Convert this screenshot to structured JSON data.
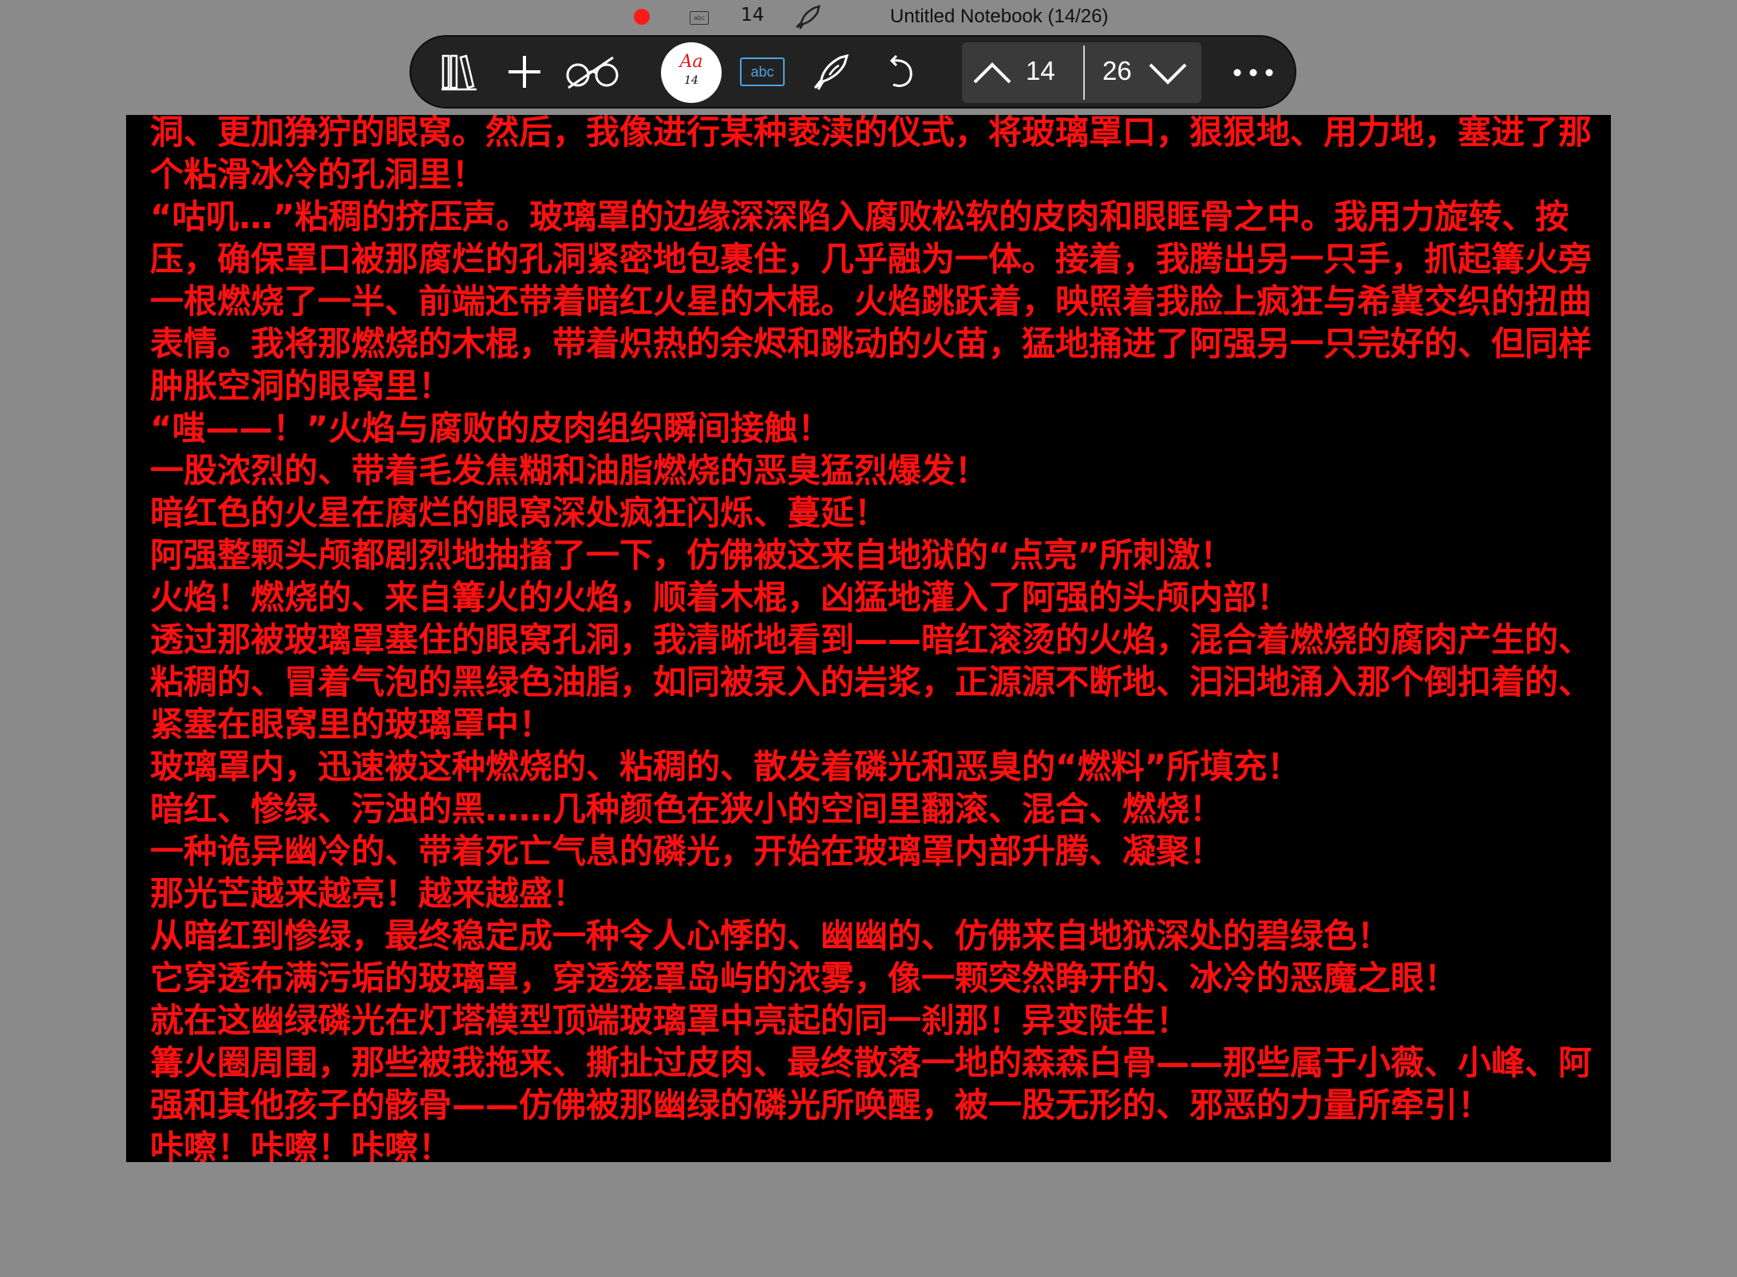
{
  "statusbar": {
    "record_indicator": "record-dot",
    "abc_icon": "abc",
    "page_number": "14",
    "window_title": "Untitled Notebook (14/26)"
  },
  "toolbar": {
    "font_button": {
      "label": "Aa",
      "size": "14"
    },
    "abc_label": "abc",
    "current_page": "14",
    "total_pages": "26",
    "icons": [
      "library-icon",
      "add-icon",
      "glasses-icon",
      "font-icon",
      "abc-icon",
      "pen-hand-icon",
      "undo-icon",
      "chevron-up-icon",
      "chevron-down-icon",
      "more-icon"
    ]
  },
  "document": {
    "paragraphs": [
      "洞、更加狰狞的眼窝。然后，我像进行某种亵渎的仪式，将玻璃罩口，狠狠地、用力地，塞进了那个粘滑冰冷的孔洞里！",
      "“咕叽…”粘稠的挤压声。玻璃罩的边缘深深陷入腐败松软的皮肉和眼眶骨之中。我用力旋转、按压，确保罩口被那腐烂的孔洞紧密地包裹住，几乎融为一体。接着，我腾出另一只手，抓起篝火旁一根燃烧了一半、前端还带着暗红火星的木棍。火焰跳跃着，映照着我脸上疯狂与希冀交织的扭曲表情。我将那燃烧的木棍，带着炽热的余烬和跳动的火苗，猛地捅进了阿强另一只完好的、但同样肿胀空洞的眼窝里！",
      "“嗤——！”火焰与腐败的皮肉组织瞬间接触！",
      "一股浓烈的、带着毛发焦糊和油脂燃烧的恶臭猛烈爆发！",
      "暗红色的火星在腐烂的眼窝深处疯狂闪烁、蔓延！",
      "阿强整颗头颅都剧烈地抽搐了一下，仿佛被这来自地狱的“点亮”所刺激！",
      "火焰！燃烧的、来自篝火的火焰，顺着木棍，凶猛地灌入了阿强的头颅内部！",
      "透过那被玻璃罩塞住的眼窝孔洞，我清晰地看到——暗红滚烫的火焰，混合着燃烧的腐肉产生的、粘稠的、冒着气泡的黑绿色油脂，如同被泵入的岩浆，正源源不断地、汩汩地涌入那个倒扣着的、紧塞在眼窝里的玻璃罩中！",
      "玻璃罩内，迅速被这种燃烧的、粘稠的、散发着磷光和恶臭的“燃料”所填充！",
      "暗红、惨绿、污浊的黑……几种颜色在狭小的空间里翻滚、混合、燃烧！",
      "一种诡异幽冷的、带着死亡气息的磷光，开始在玻璃罩内部升腾、凝聚！",
      "那光芒越来越亮！越来越盛！",
      "从暗红到惨绿，最终稳定成一种令人心悸的、幽幽的、仿佛来自地狱深处的碧绿色！",
      "它穿透布满污垢的玻璃罩，穿透笼罩岛屿的浓雾，像一颗突然睁开的、冰冷的恶魔之眼！",
      "就在这幽绿磷光在灯塔模型顶端玻璃罩中亮起的同一刹那！异变陡生！",
      "篝火圈周围，那些被我拖来、撕扯过皮肉、最终散落一地的森森白骨——那些属于小薇、小峰、阿强和其他孩子的骸骨——仿佛被那幽绿的磷光所唤醒，被一股无形的、邪恶的力量所牵引！",
      "咔嚓！咔嚓！咔嚓！"
    ]
  },
  "colors": {
    "background": "#8a8a8a",
    "page": "#000000",
    "text": "#ff1010",
    "toolbar": "#222222",
    "accent_blue": "#4aa3e0",
    "record": "#ff1a1a"
  }
}
